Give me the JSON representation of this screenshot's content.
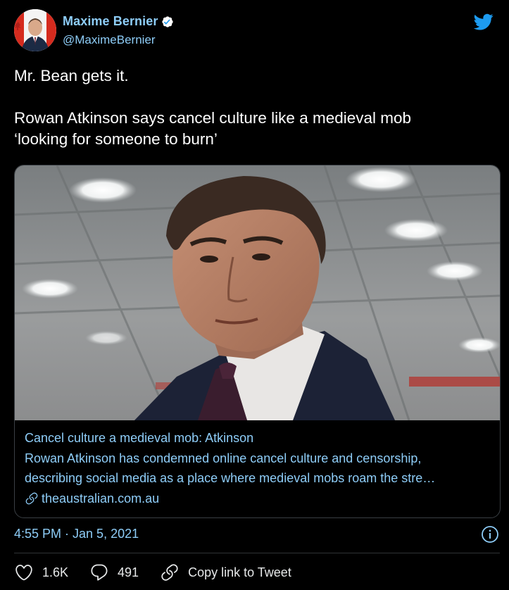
{
  "author": {
    "display_name": "Maxime Bernier",
    "handle": "@MaximeBernier",
    "verified": true
  },
  "tweet": {
    "line1": "Mr. Bean gets it.",
    "line2": "Rowan Atkinson says cancel culture like a medieval mob",
    "line3": "‘looking for someone to burn’"
  },
  "card": {
    "title": "Cancel culture a medieval mob: Atkinson",
    "description_line1": "Rowan Atkinson has condemned online cancel culture and censorship,",
    "description_line2": "describing social media as a place where medieval mobs roam the stre…",
    "domain": "theaustralian.com.au"
  },
  "timestamp": "4:55 PM · Jan 5, 2021",
  "actions": {
    "likes": "1.6K",
    "replies": "491",
    "copy_link_label": "Copy link to Tweet"
  },
  "colors": {
    "background": "#000000",
    "link_blue": "#8ecdf8",
    "twitter_blue": "#1d9bf0",
    "text": "#ffffff",
    "border": "#3a3f44"
  },
  "icons": [
    "verified-badge-icon",
    "twitter-bird-icon",
    "link-icon",
    "info-icon",
    "heart-icon",
    "reply-icon",
    "copy-link-icon"
  ]
}
